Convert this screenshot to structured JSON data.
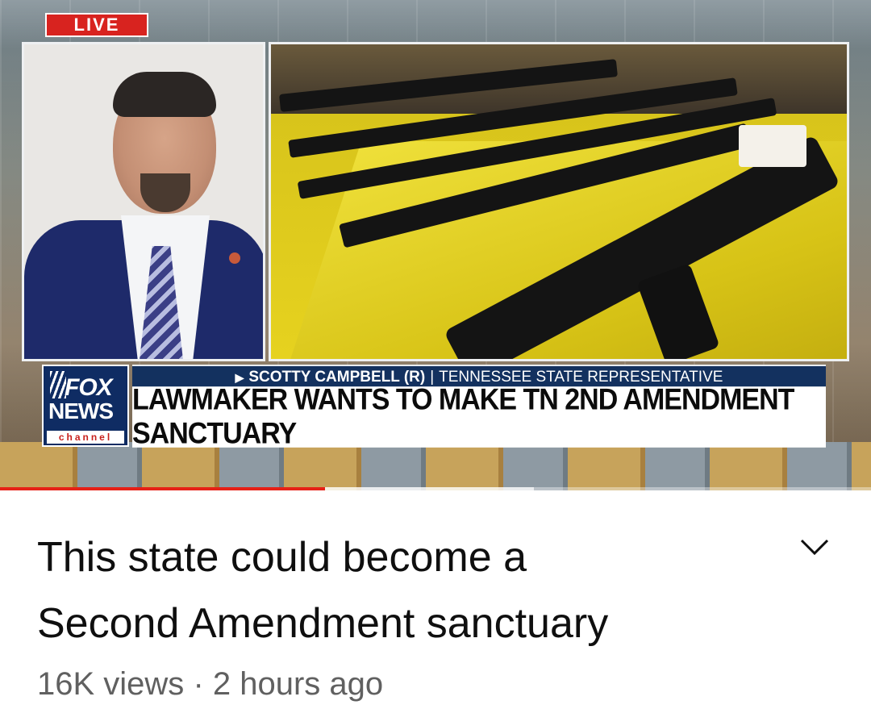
{
  "player": {
    "live_badge": "LIVE",
    "network_logo": {
      "top": "FOX",
      "middle": "NEWS",
      "bottom": "channel"
    },
    "chyron_top": {
      "name": "SCOTTY CAMPBELL (R)",
      "separator": "|",
      "role": "TENNESSEE STATE REPRESENTATIVE"
    },
    "chyron_headline": "LAWMAKER WANTS TO MAKE TN 2ND AMENDMENT SANCTUARY",
    "progress_fraction": 0.373
  },
  "video": {
    "title_line1": "This state could become a",
    "title_line2": "Second Amendment sanctuary",
    "views": "16K views",
    "dot": "·",
    "age": "2 hours ago",
    "expand_icon": "chevron-down-icon"
  },
  "colors": {
    "live_red": "#d8231f",
    "fox_blue": "#0f2c63",
    "chyron_blue": "#13315f",
    "progress_red": "#e62117",
    "title_text": "#0f0f0f",
    "meta_text": "#606060"
  }
}
